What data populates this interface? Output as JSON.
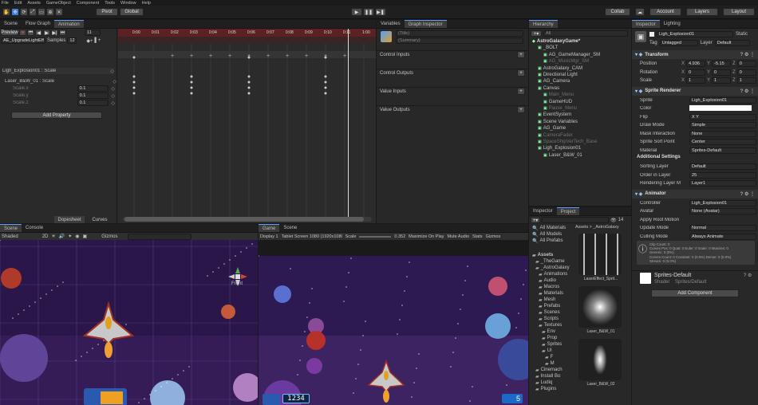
{
  "menu": [
    "File",
    "Edit",
    "Assets",
    "GameObject",
    "Component",
    "Tools",
    "Window",
    "Help"
  ],
  "toolbar": {
    "pivot": "Pivot",
    "global": "Global",
    "collab": "Collab",
    "account": "Account",
    "layers": "Layers",
    "layout": "Layout"
  },
  "animation": {
    "tabs": [
      "Scene",
      "Flow Graph",
      "Animation"
    ],
    "preview": "Preview",
    "frame": "11",
    "clip": "AE_UpgradeLightEff",
    "samples_label": "Samples",
    "samples": "12",
    "ruler": [
      "0:00",
      "0:01",
      "0:02",
      "0:03",
      "0:04",
      "0:05",
      "0:06",
      "0:07",
      "0:08",
      "0:09",
      "0:10",
      "0:11",
      "1:00"
    ],
    "props": [
      {
        "name": "Ligh_Explosion01 : Scale",
        "value": ""
      },
      {
        "name": "Laser_B&W_01 : Scale",
        "value": ""
      },
      {
        "name": "Scale.x",
        "value": "0.1"
      },
      {
        "name": "Scale.y",
        "value": "0.1"
      },
      {
        "name": "Scale.z",
        "value": "0.1"
      }
    ],
    "add_property": "Add Property",
    "dopesheet": "Dopesheet",
    "curves": "Curves"
  },
  "variables": {
    "tabs": [
      "Variables",
      "Graph Inspector"
    ],
    "title": "(Title)",
    "summary": "(Summary)",
    "sections": [
      "Control Inputs",
      "Control Outputs",
      "Value Inputs",
      "Value Outputs"
    ]
  },
  "hierarchy": {
    "tab": "Hierarchy",
    "search": "All",
    "items": [
      {
        "label": "AstroGalaxyGame*",
        "indent": 0
      },
      {
        "label": "_BOLT",
        "indent": 1
      },
      {
        "label": "AG_GameManager_SM",
        "indent": 2
      },
      {
        "label": "AG_MusicMgr_SM",
        "indent": 2
      },
      {
        "label": "AstroGalaxy_CAM",
        "indent": 1
      },
      {
        "label": "Directional Light",
        "indent": 1
      },
      {
        "label": "AG_Camera",
        "indent": 1
      },
      {
        "label": "Canvas",
        "indent": 1
      },
      {
        "label": "Main_Menu",
        "indent": 2
      },
      {
        "label": "GameHUD",
        "indent": 2
      },
      {
        "label": "Pause_Menu",
        "indent": 2
      },
      {
        "label": "EventSystem",
        "indent": 1
      },
      {
        "label": "Scene Variables",
        "indent": 1
      },
      {
        "label": "AG_Game",
        "indent": 1
      },
      {
        "label": "CameraFader",
        "indent": 1
      },
      {
        "label": "SpaceShipVerTech_Base",
        "indent": 1
      },
      {
        "label": "Ligh_Explosion01",
        "indent": 1
      },
      {
        "label": "Laser_B&W_01",
        "indent": 2
      }
    ]
  },
  "inspector": {
    "tabs": [
      "Inspector",
      "Lighting"
    ],
    "object_name": "Ligh_Explosion01",
    "static": "Static",
    "tag_label": "Tag",
    "tag": "Untagged",
    "layer_label": "Layer",
    "layer": "Default",
    "transform": {
      "title": "Transform",
      "rows": [
        {
          "label": "Position",
          "x": "4.936",
          "y": "-5.15",
          "z": "0"
        },
        {
          "label": "Rotation",
          "x": "0",
          "y": "0",
          "z": "0"
        },
        {
          "label": "Scale",
          "x": "1",
          "y": "1",
          "z": "1"
        }
      ]
    },
    "sprite_renderer": {
      "title": "Sprite Renderer",
      "rows": [
        {
          "label": "Sprite",
          "value": "Ligh_Explosion01"
        },
        {
          "label": "Color",
          "value": ""
        },
        {
          "label": "Flip",
          "value": "X  Y"
        },
        {
          "label": "Draw Mode",
          "value": "Simple"
        },
        {
          "label": "Mask Interaction",
          "value": "None"
        },
        {
          "label": "Sprite Sort Point",
          "value": "Center"
        },
        {
          "label": "Material",
          "value": "Sprites-Default"
        }
      ],
      "additional": "Additional Settings",
      "add_rows": [
        {
          "label": "Sorting Layer",
          "value": "Default"
        },
        {
          "label": "Order in Layer",
          "value": "25"
        },
        {
          "label": "Rendering Layer M",
          "value": "Layer1"
        }
      ]
    },
    "animator": {
      "title": "Animator",
      "rows": [
        {
          "label": "Controller",
          "value": "Ligh_Explosion01"
        },
        {
          "label": "Avatar",
          "value": "None (Avatar)"
        },
        {
          "label": "Apply Root Motion",
          "value": ""
        },
        {
          "label": "Update Mode",
          "value": "Normal"
        },
        {
          "label": "Culling Mode",
          "value": "Always Animate"
        }
      ],
      "info": [
        "Clip Count: 0",
        "Curves Pos: 0 Quat: 0 Euler: 0 Scale: 0 Muscles: 0",
        "Generic: 0 (0%)",
        "Curves Count: 0 Constant: 0 (0.0%) Dense: 0 (0.0%)",
        "Stream: 0 (0.0%)"
      ]
    },
    "material_name": "Sprites-Default",
    "shader_label": "Shader",
    "shader": "Sprites/Default",
    "add_component": "Add Component"
  },
  "project": {
    "tabs": [
      "Inspector",
      "Project"
    ],
    "count": "14",
    "favorites": [
      "All Materials",
      "All Models",
      "All Prefabs"
    ],
    "breadcrumb": "Assets > _AstroGalaxy",
    "tree": [
      "Assets",
      "_TheGame",
      "_AstroGalaxy",
      "Animations",
      "Audio",
      "Macros",
      "Materials",
      "Mesh",
      "Prefabs",
      "Scenes",
      "Scripts",
      "Textures",
      "Env",
      "Prop",
      "Sprites",
      "UI",
      "F",
      "M",
      "Cinemach",
      "Install Bo",
      "Ludiq",
      "Plugins"
    ],
    "thumbs": [
      "LaserEffect_Sprit...",
      "Laser_B&W_01",
      "Laser_B&W_02"
    ]
  },
  "scene_view": {
    "tabs": [
      "Scene",
      "Console"
    ],
    "shading": "Shaded",
    "mode": "2D",
    "gizmos": "Gizmos",
    "persp": "Front"
  },
  "game_view": {
    "tabs": [
      "Game",
      "Scene"
    ],
    "display": "Display 1",
    "resolution": "Tablet Screen 1080 (1920x1080)",
    "scale_label": "Scale",
    "scale": "0.352",
    "maximize": "Maximize On Play",
    "mute": "Mute Audio",
    "stats": "Stats",
    "gizmos": "Gizmos",
    "score": "1234",
    "lives": "5"
  },
  "colors": {
    "accent": "#3d7fe0",
    "record": "#b33030",
    "bg": "#282828",
    "space": "#2a1648"
  }
}
